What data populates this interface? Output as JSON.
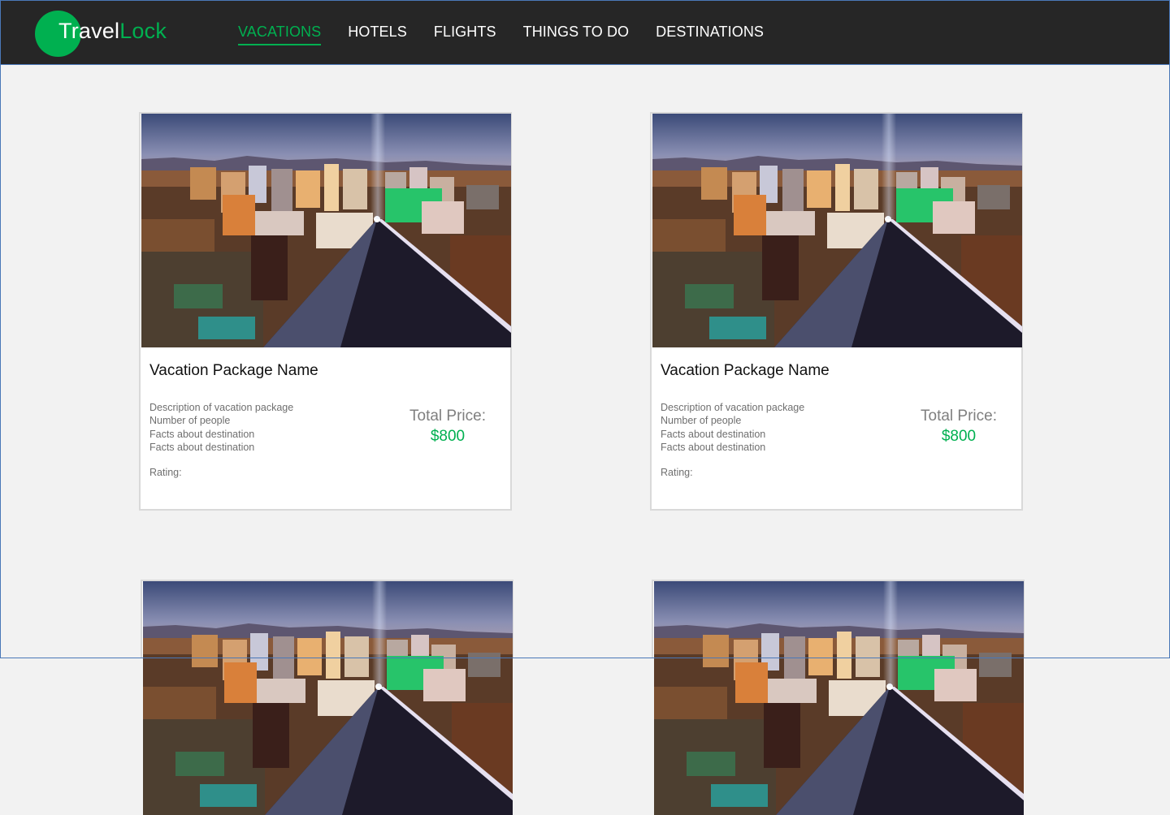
{
  "header": {
    "logo": {
      "part1": "Travel",
      "part2": "Lock"
    },
    "nav": [
      {
        "label": "VACATIONS",
        "active": true
      },
      {
        "label": "HOTELS",
        "active": false
      },
      {
        "label": "FLIGHTS",
        "active": false
      },
      {
        "label": "THINGS TO DO",
        "active": false
      },
      {
        "label": "DESTINATIONS",
        "active": false
      }
    ]
  },
  "cards": [
    {
      "title": "Vacation Package Name",
      "description": [
        "Description of vacation package",
        "Number of people",
        "Facts about destination",
        "Facts about destination"
      ],
      "rating_label": "Rating:",
      "price_label": "Total Price:",
      "price": "$800"
    },
    {
      "title": "Vacation Package Name",
      "description": [
        "Description of vacation package",
        "Number of people",
        "Facts about destination",
        "Facts about destination"
      ],
      "rating_label": "Rating:",
      "price_label": "Total Price:",
      "price": "$800"
    },
    {},
    {}
  ],
  "colors": {
    "accent": "#00b050",
    "header_bg": "#262626",
    "page_bg": "#f2f2f2"
  }
}
